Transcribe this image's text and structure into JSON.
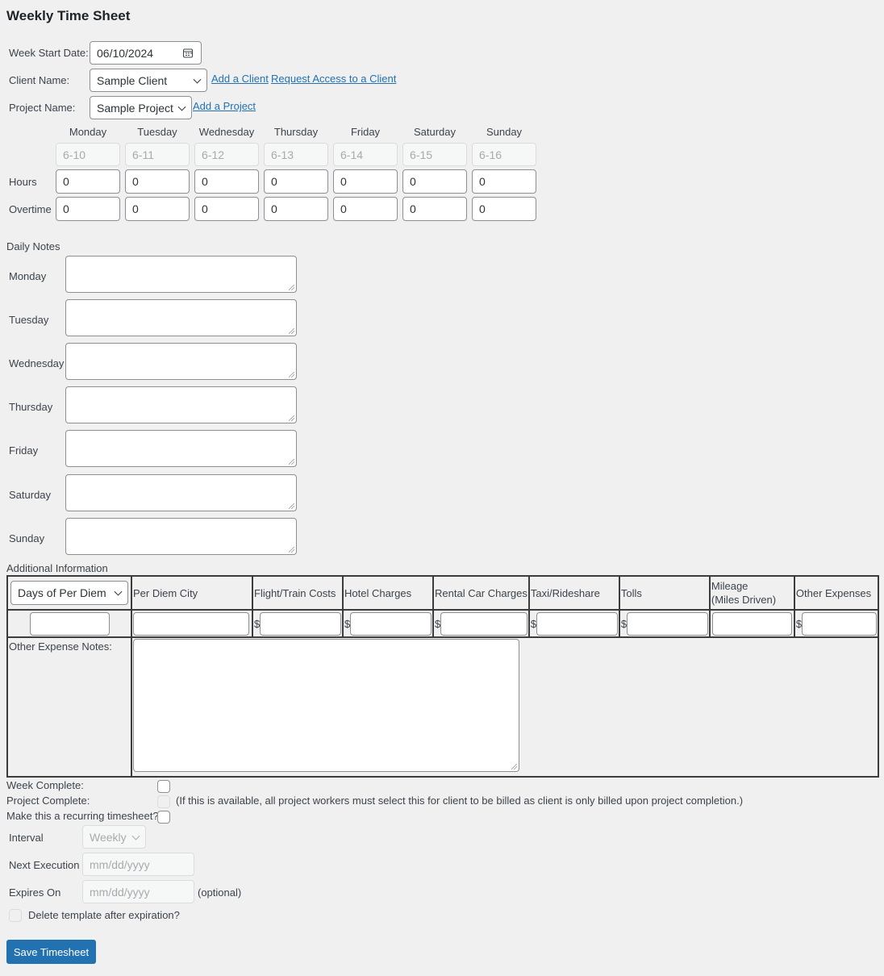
{
  "page": {
    "title": "Weekly Time Sheet"
  },
  "header_form": {
    "week_start_label": "Week Start Date:",
    "week_start_value": "06/10/2024",
    "client_label": "Client Name:",
    "client_value": "Sample Client",
    "add_client_link": "Add a Client",
    "request_access_link": "Request Access to a Client",
    "project_label": "Project Name:",
    "project_value": "Sample Project",
    "add_project_link": "Add a Project"
  },
  "hours_grid": {
    "days": [
      {
        "name": "Monday",
        "date": "6-10",
        "hours": "0",
        "overtime": "0"
      },
      {
        "name": "Tuesday",
        "date": "6-11",
        "hours": "0",
        "overtime": "0"
      },
      {
        "name": "Wednesday",
        "date": "6-12",
        "hours": "0",
        "overtime": "0"
      },
      {
        "name": "Thursday",
        "date": "6-13",
        "hours": "0",
        "overtime": "0"
      },
      {
        "name": "Friday",
        "date": "6-14",
        "hours": "0",
        "overtime": "0"
      },
      {
        "name": "Saturday",
        "date": "6-15",
        "hours": "0",
        "overtime": "0"
      },
      {
        "name": "Sunday",
        "date": "6-16",
        "hours": "0",
        "overtime": "0"
      }
    ],
    "hours_label": "Hours",
    "overtime_label": "Overtime"
  },
  "daily_notes": {
    "heading": "Daily Notes",
    "days": [
      "Monday",
      "Tuesday",
      "Wednesday",
      "Thursday",
      "Friday",
      "Saturday",
      "Sunday"
    ]
  },
  "additional_info": {
    "heading": "Additional Information",
    "per_diem_select": "Days of Per Diem",
    "columns": [
      "Per Diem City",
      "Flight/Train Costs",
      "Hotel Charges",
      "Rental Car Charges",
      "Taxi/Rideshare",
      "Tolls",
      "Mileage (Miles Driven)",
      "Other Expenses"
    ],
    "mileage_line1": "Mileage",
    "mileage_line2": "(Miles Driven)",
    "currency_symbol": "$",
    "other_expense_notes_label": "Other Expense Notes:"
  },
  "completion": {
    "week_complete_label": "Week Complete:",
    "project_complete_label": "Project Complete:",
    "project_complete_note": "(If this is available, all project workers must select this for client to be billed as client is only billed upon project completion.)",
    "recurring_label": "Make this a recurring timesheet?"
  },
  "recurring": {
    "interval_label": "Interval",
    "interval_value": "Weekly",
    "next_execution_label": "Next Execution",
    "next_execution_placeholder": "mm/dd/yyyy",
    "expires_on_label": "Expires On",
    "expires_on_placeholder": "mm/dd/yyyy",
    "optional_note": "(optional)",
    "delete_template_label": "Delete template after expiration?"
  },
  "actions": {
    "save_label": "Save Timesheet"
  },
  "colors": {
    "accent": "#2271b1",
    "background": "#f0f0f1"
  }
}
